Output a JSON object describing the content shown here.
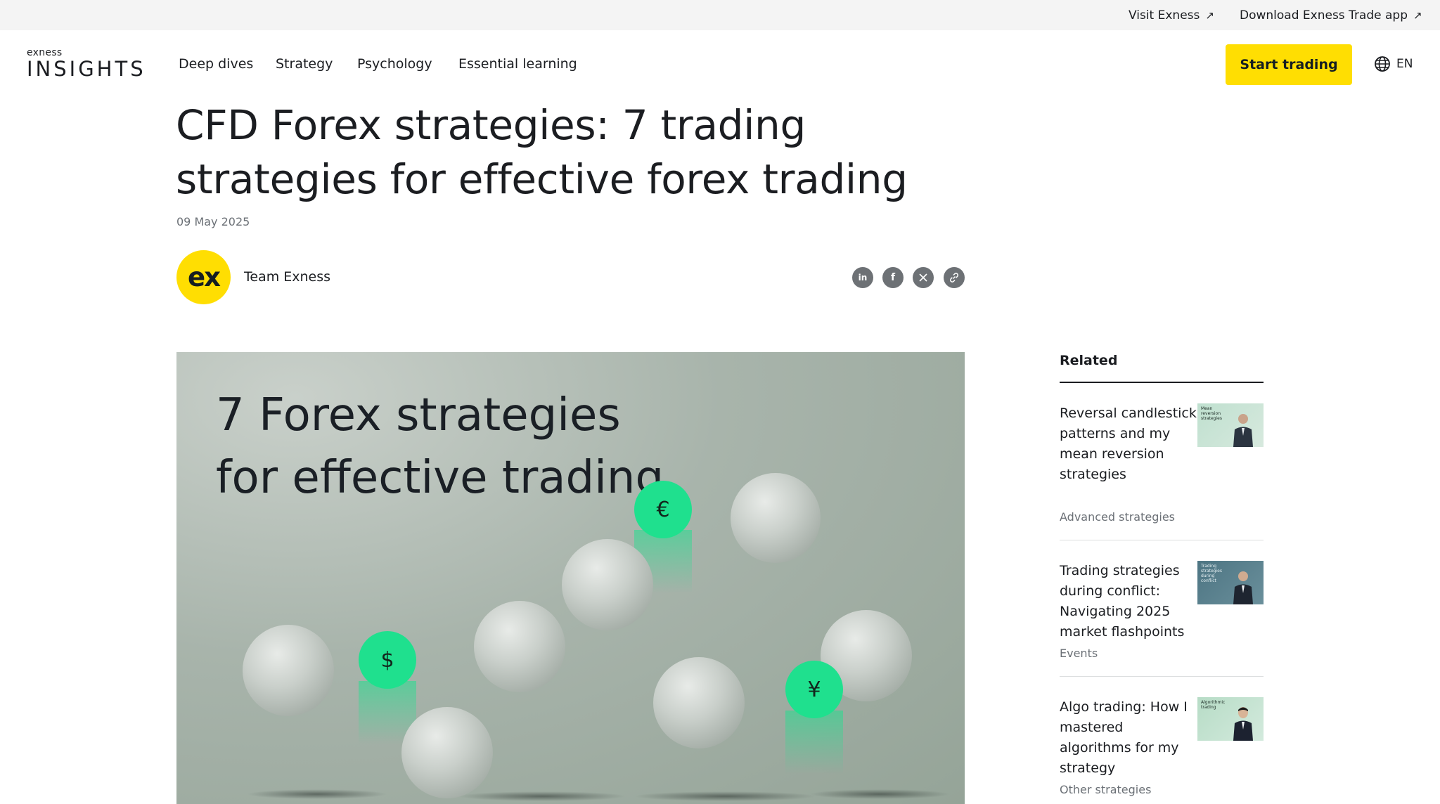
{
  "topbar": {
    "visit_label": "Visit Exness",
    "download_label": "Download Exness Trade app"
  },
  "header": {
    "logo_small": "exness",
    "logo_big": "INSIGHTS",
    "nav": [
      "Deep dives",
      "Strategy",
      "Psychology",
      "Essential learning"
    ],
    "cta_label": "Start trading",
    "lang_label": "EN"
  },
  "article": {
    "title": "CFD Forex strategies: 7 trading strategies for effective forex trading",
    "date": "09 May 2025",
    "avatar_text": "ex",
    "author": "Team Exness",
    "share_icons": [
      "linkedin-icon",
      "facebook-icon",
      "x-icon",
      "link-icon"
    ],
    "hero_text": "7 Forex strategies for effective trading",
    "coins": [
      "€",
      "$",
      "¥"
    ]
  },
  "related": {
    "heading": "Related",
    "items": [
      {
        "title": "Reversal candlestick patterns and my mean reversion strategies",
        "category": "Advanced strategies",
        "thumb_text": "Mean reversion strategies"
      },
      {
        "title": "Trading strategies during conflict: Navigating 2025 market flashpoints",
        "category": "Events",
        "thumb_text": "Trading strategies during conflict"
      },
      {
        "title": "Algo trading: How I mastered algorithms for my strategy",
        "category": "Other strategies",
        "thumb_text": "Algorithmic trading"
      }
    ]
  },
  "colors": {
    "accent_yellow": "#ffde02",
    "coin_green": "#1fe08e",
    "text_dark": "#1b1d21",
    "muted": "#6b7076"
  }
}
